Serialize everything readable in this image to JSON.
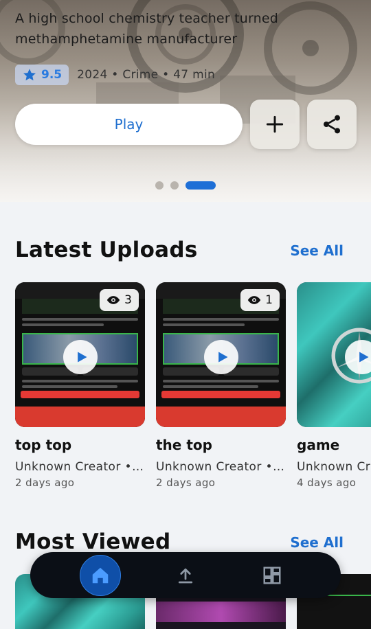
{
  "hero": {
    "description": "A high school chemistry teacher turned methamphetamine manufacturer",
    "rating": "9.5",
    "meta": "2024 • Crime • 47 min",
    "play_label": "Play",
    "add_icon": "plus-icon",
    "share_icon": "share-icon",
    "carousel": {
      "count": 3,
      "active_index": 2
    }
  },
  "latest": {
    "title": "Latest Uploads",
    "see_all": "See All",
    "items": [
      {
        "title": "top top",
        "creator": "Unknown Creator • …",
        "time": "2 days ago",
        "views": "3",
        "thumb": "phone-screenshot"
      },
      {
        "title": "the top",
        "creator": "Unknown Creator • …",
        "time": "2 days ago",
        "views": "1",
        "thumb": "phone-screenshot"
      },
      {
        "title": "game",
        "creator": "Unknown Cr",
        "time": "4 days ago",
        "views": "",
        "thumb": "teal-logo"
      }
    ]
  },
  "most_viewed": {
    "title": "Most Viewed",
    "see_all": "See All"
  },
  "nav": {
    "items": [
      {
        "name": "home",
        "icon": "home-icon",
        "active": true
      },
      {
        "name": "upload",
        "icon": "upload-icon",
        "active": false
      },
      {
        "name": "dashboard",
        "icon": "dashboard-icon",
        "active": false
      }
    ]
  },
  "colors": {
    "accent": "#1f6fcf",
    "nav_bg": "#0b0f16",
    "nav_active": "#0f4fa8",
    "page_bg": "#f1f3f6"
  }
}
